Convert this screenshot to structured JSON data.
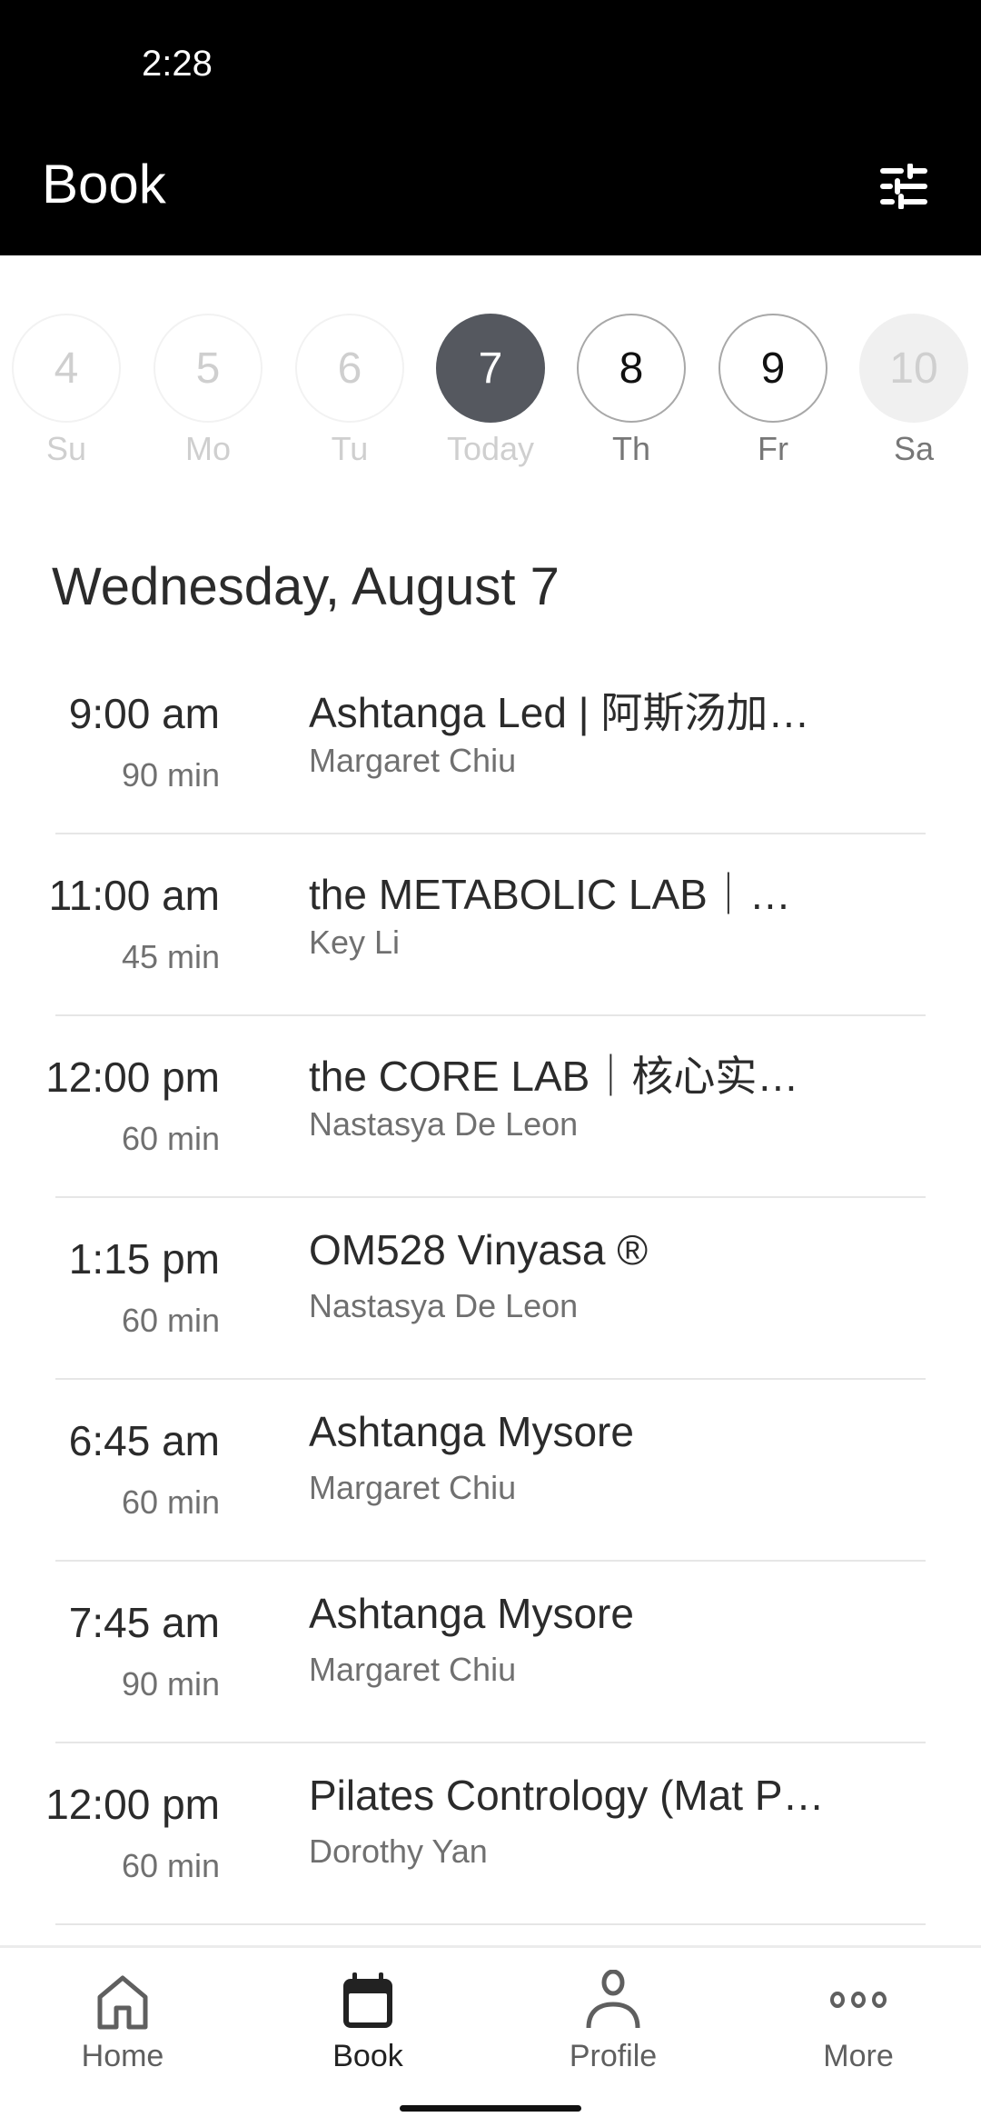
{
  "status_bar": {
    "time": "2:28"
  },
  "app_bar": {
    "title": "Book",
    "filter_icon": "tune-sliders-icon"
  },
  "date_strip": [
    {
      "date": "4",
      "day": "Su",
      "state": "past"
    },
    {
      "date": "5",
      "day": "Mo",
      "state": "past"
    },
    {
      "date": "6",
      "day": "Tu",
      "state": "past"
    },
    {
      "date": "7",
      "day": "Today",
      "state": "selected"
    },
    {
      "date": "8",
      "day": "Th",
      "state": "future"
    },
    {
      "date": "9",
      "day": "Fr",
      "state": "future"
    },
    {
      "date": "10",
      "day": "Sa",
      "state": "disabled"
    }
  ],
  "schedule": {
    "heading": "Wednesday, August 7",
    "classes": [
      {
        "time": "9:00 am",
        "duration": "90 min",
        "name": "Ashtanga Led | 阿斯汤加…",
        "teacher": "Margaret Chiu"
      },
      {
        "time": "11:00 am",
        "duration": "45 min",
        "name": "the METABOLIC LAB｜…",
        "teacher": "Key Li"
      },
      {
        "time": "12:00 pm",
        "duration": "60 min",
        "name": "the CORE LAB｜核心实…",
        "teacher": "Nastasya De Leon"
      },
      {
        "time": "1:15 pm",
        "duration": "60 min",
        "name": "OM528 Vinyasa ®",
        "teacher": "Nastasya De Leon"
      },
      {
        "time": "6:45 am",
        "duration": "60 min",
        "name": "Ashtanga Mysore",
        "teacher": "Margaret Chiu"
      },
      {
        "time": "7:45 am",
        "duration": "90 min",
        "name": "Ashtanga Mysore",
        "teacher": "Margaret Chiu"
      },
      {
        "time": "12:00 pm",
        "duration": "60 min",
        "name": "Pilates Contrology (Mat P…",
        "teacher": "Dorothy Yan"
      }
    ]
  },
  "bottom_nav": [
    {
      "label": "Home",
      "icon": "home-icon",
      "active": false
    },
    {
      "label": "Book",
      "icon": "calendar-icon",
      "active": true
    },
    {
      "label": "Profile",
      "icon": "person-icon",
      "active": false
    },
    {
      "label": "More",
      "icon": "more-dots-icon",
      "active": false
    }
  ],
  "colors": {
    "selected_day": "#55585f",
    "header_bg": "#000000"
  }
}
